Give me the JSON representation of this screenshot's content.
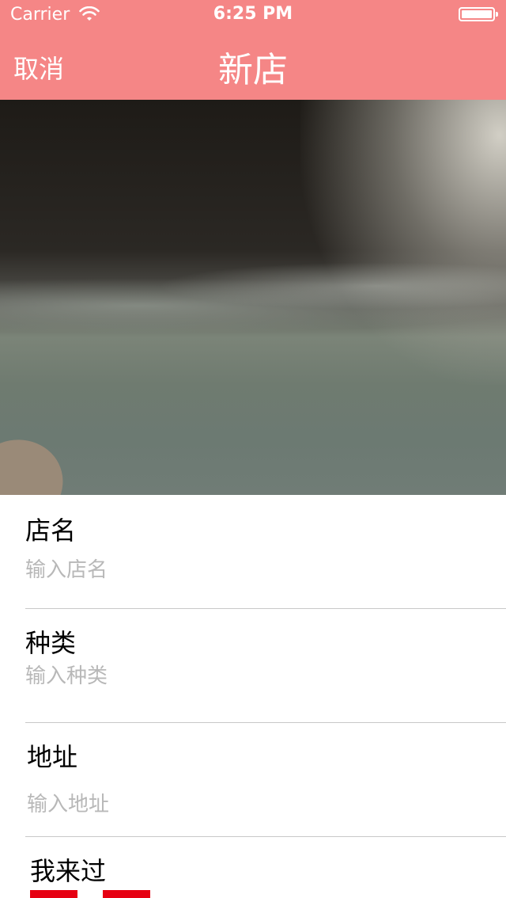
{
  "status_bar": {
    "carrier": "Carrier",
    "time": "6:25 PM"
  },
  "nav": {
    "cancel_label": "取消",
    "title": "新店",
    "background_color": "#f58686"
  },
  "photo": {
    "description_icon": "photo-image"
  },
  "form": {
    "name": {
      "label": "店名",
      "placeholder": "输入店名"
    },
    "type": {
      "label": "种类",
      "placeholder": "输入种类"
    },
    "address": {
      "label": "地址",
      "placeholder": "输入地址"
    },
    "visited": {
      "label": "我来过",
      "accent_color": "#e60012"
    }
  }
}
